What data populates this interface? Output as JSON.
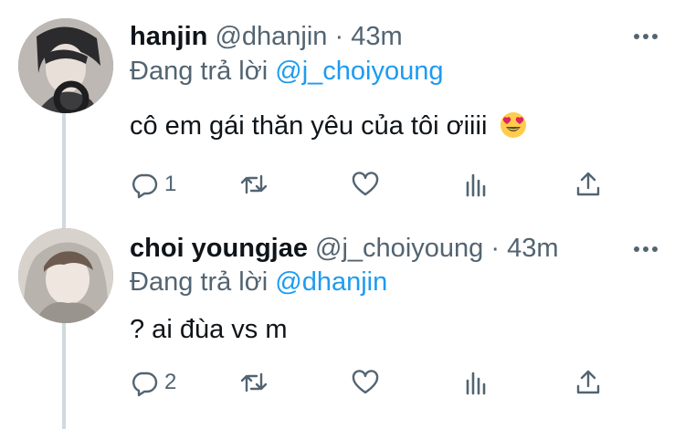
{
  "tweets": [
    {
      "name": "hanjin",
      "handle": "@dhanjin",
      "separator": "·",
      "time": "43m",
      "reply_prefix": "Đang trả lời ",
      "reply_to": "@j_choiyoung",
      "text": "cô em gái thăn yêu của tôi ơiiii",
      "emoji": "smiling-face-with-heart-eyes",
      "reply_count": "1"
    },
    {
      "name": "choi youngjae",
      "handle": "@j_choiyoung",
      "separator": "·",
      "time": "43m",
      "reply_prefix": "Đang trả lời ",
      "reply_to": "@dhanjin",
      "text": "? ai đùa vs m",
      "reply_count": "2"
    }
  ],
  "icons": {
    "reply": "comment-bubble-icon",
    "retweet": "retweet-arrows-icon",
    "like": "heart-outline-icon",
    "views": "bar-chart-icon",
    "share": "share-upload-icon",
    "more": "more-dots-icon"
  },
  "colors": {
    "text": "#0f1419",
    "secondary": "#536471",
    "link": "#1d9bf0",
    "thread_line": "#cfd9de"
  }
}
